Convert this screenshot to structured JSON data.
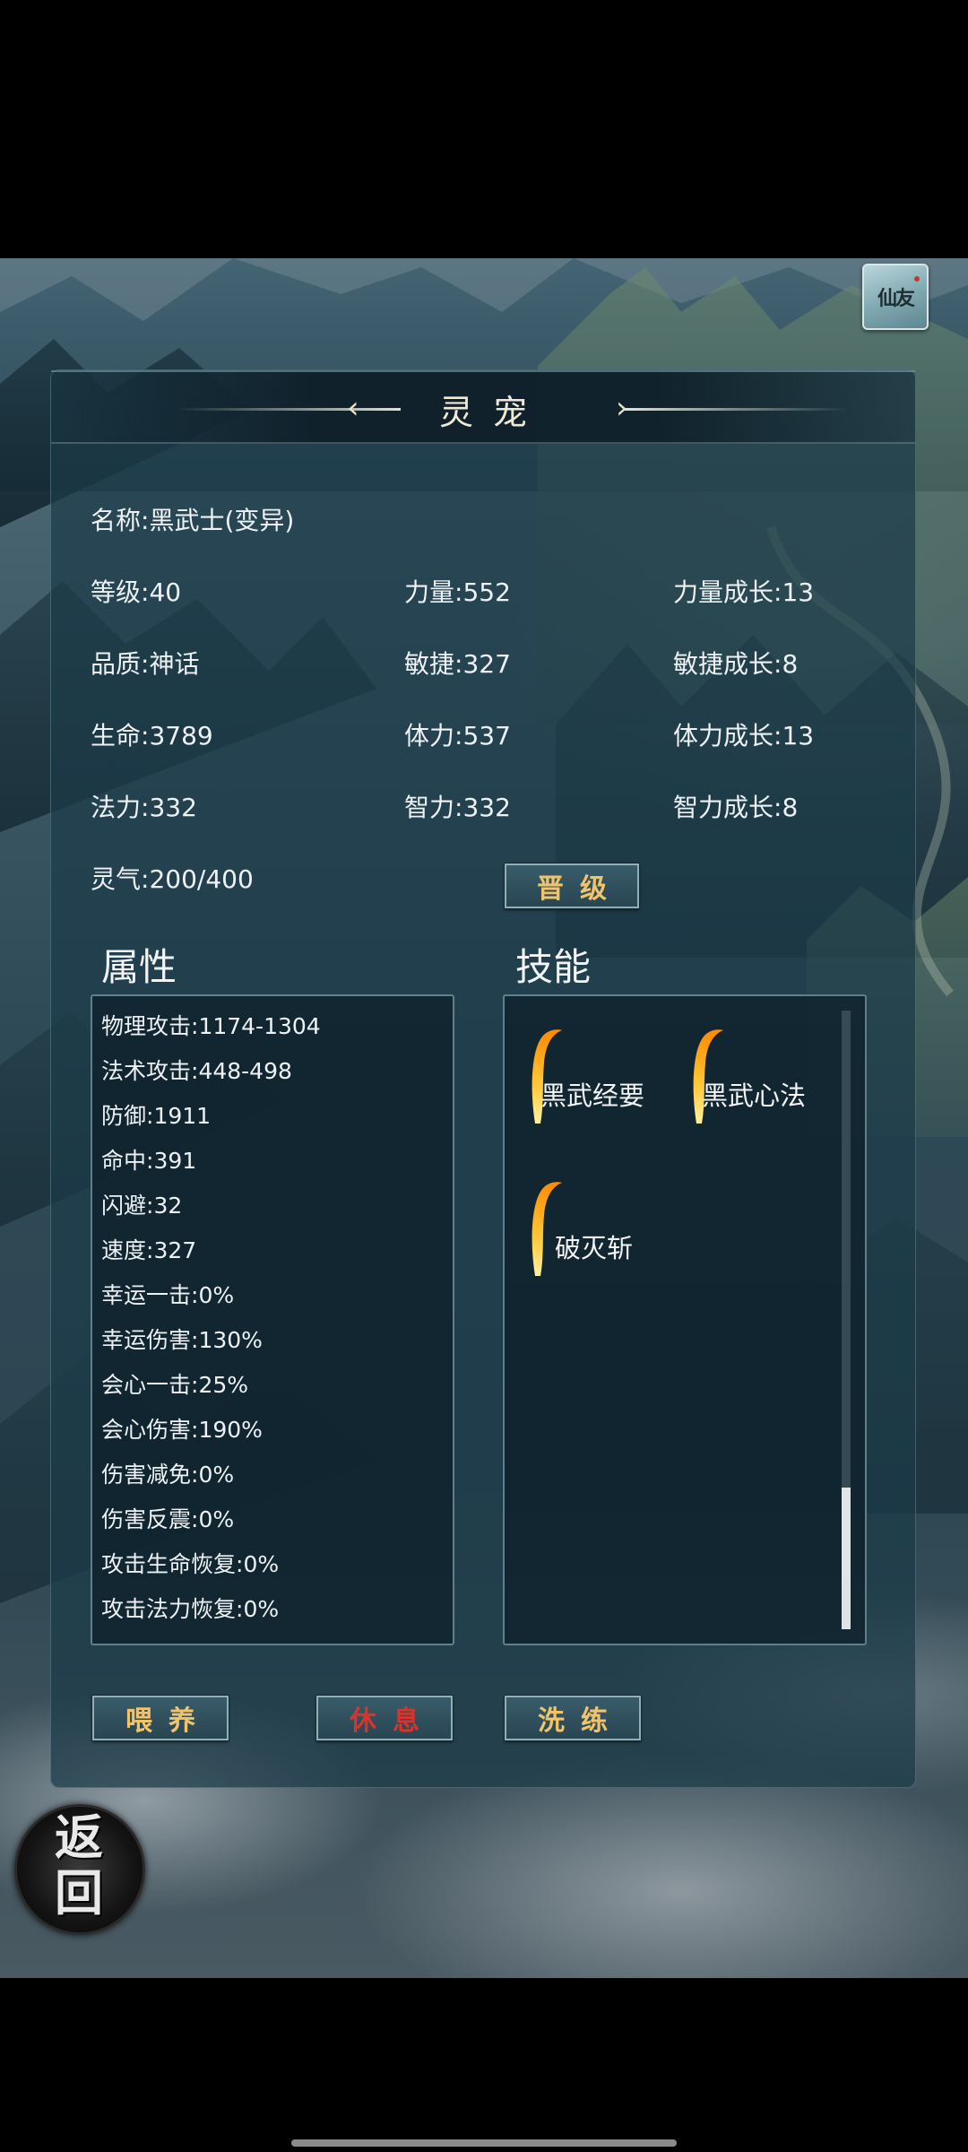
{
  "header": {
    "title": "灵宠",
    "corner_icon_text": "仙友"
  },
  "pet_info": {
    "name": {
      "label": "名称:",
      "value": "黑武士(变异)"
    },
    "level": {
      "label": "等级:",
      "value": "40"
    },
    "quality": {
      "label": "品质:",
      "value": "神话"
    },
    "hp": {
      "label": "生命:",
      "value": "3789"
    },
    "mp": {
      "label": "法力:",
      "value": "332"
    },
    "aura": {
      "label": "灵气:",
      "value": "200/400"
    },
    "strength": {
      "label": "力量:",
      "value": "552"
    },
    "agility": {
      "label": "敏捷:",
      "value": "327"
    },
    "stamina": {
      "label": "体力:",
      "value": "537"
    },
    "intellect": {
      "label": "智力:",
      "value": "332"
    },
    "strength_growth": {
      "label": "力量成长:",
      "value": "13"
    },
    "agility_growth": {
      "label": "敏捷成长:",
      "value": "8"
    },
    "stamina_growth": {
      "label": "体力成长:",
      "value": "13"
    },
    "intellect_growth": {
      "label": "智力成长:",
      "value": "8"
    }
  },
  "upgrade_button": "晋级",
  "attributes": {
    "heading": "属性",
    "rows": [
      {
        "label": "物理攻击:",
        "value": "1174-1304"
      },
      {
        "label": "法术攻击:",
        "value": "448-498"
      },
      {
        "label": "防御:",
        "value": "1911"
      },
      {
        "label": "命中:",
        "value": "391"
      },
      {
        "label": "闪避:",
        "value": "32"
      },
      {
        "label": "速度:",
        "value": "327"
      },
      {
        "label": "幸运一击:",
        "value": "0%"
      },
      {
        "label": "幸运伤害:",
        "value": "130%"
      },
      {
        "label": "会心一击:",
        "value": "25%"
      },
      {
        "label": "会心伤害:",
        "value": "190%"
      },
      {
        "label": "伤害减免:",
        "value": "0%"
      },
      {
        "label": "伤害反震:",
        "value": "0%"
      },
      {
        "label": "攻击生命恢复:",
        "value": "0%"
      },
      {
        "label": "攻击法力恢复:",
        "value": "0%"
      }
    ]
  },
  "skills": {
    "heading": "技能",
    "items": [
      "黑武经要",
      "黑武心法",
      "破灭斩"
    ]
  },
  "actions": {
    "feed": "喂养",
    "rest": "休息",
    "refine": "洗练"
  },
  "back_button": "返回",
  "colors": {
    "panel_bg": "#1c3a48",
    "button_gold_text": "#f2c46a",
    "button_red_text": "#d9342b",
    "skill_flame": "#f5a623"
  }
}
